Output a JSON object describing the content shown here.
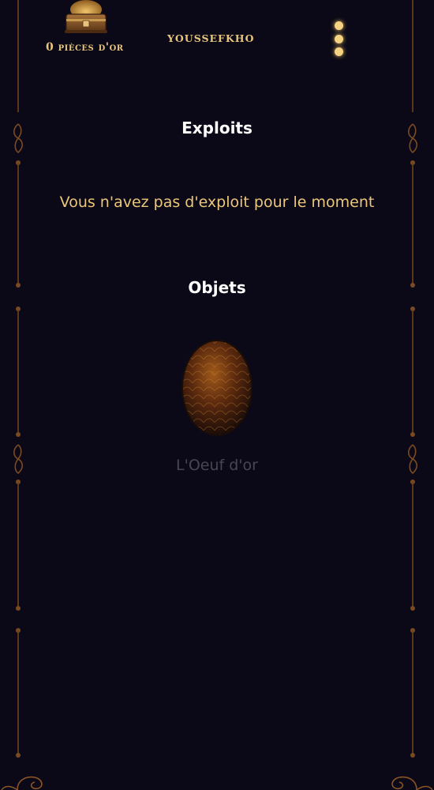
{
  "header": {
    "gold_amount": "0",
    "gold_label": "pièces d'or",
    "username": "YOUSSEFKHO",
    "menu_icon": "vertical-dots-icon",
    "chest_icon": "treasure-chest-icon"
  },
  "exploits": {
    "title": "Exploits",
    "empty_message": "Vous n'avez pas d'exploit pour le moment"
  },
  "objets": {
    "title": "Objets",
    "items": [
      {
        "name": "L'Oeuf d'or",
        "icon": "golden-egg-icon"
      }
    ]
  },
  "colors": {
    "background": "#0b0917",
    "gold_text": "#e9c67c",
    "frame": "#6a3f1c",
    "muted_text": "#4a4552"
  }
}
